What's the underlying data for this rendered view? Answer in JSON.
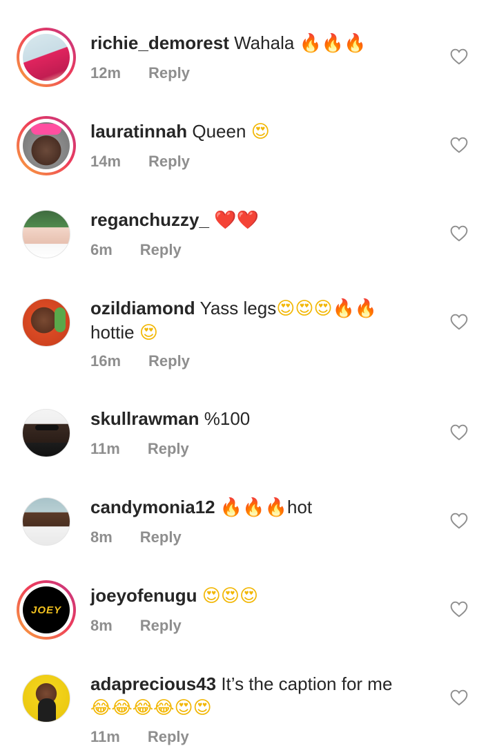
{
  "comments": [
    {
      "username": "richie_demorest",
      "text": "Wahala",
      "emoji": "🔥🔥🔥",
      "emoji2": "",
      "time": "12m",
      "reply": "Reply"
    },
    {
      "username": "lauratinnah",
      "text": "Queen",
      "emoji": "😍",
      "emoji2": "",
      "time": "14m",
      "reply": "Reply"
    },
    {
      "username": "reganchuzzy_",
      "text": "",
      "emoji": "❤️❤️",
      "emoji2": "",
      "time": "6m",
      "reply": "Reply"
    },
    {
      "username": "ozildiamond",
      "text": "Yass legs",
      "emoji": "😍😍😍🔥🔥",
      "line2": "hottie",
      "emoji2": "😍",
      "time": "16m",
      "reply": "Reply"
    },
    {
      "username": "skullrawman",
      "text": "%100",
      "emoji": "",
      "emoji2": "",
      "time": "11m",
      "reply": "Reply"
    },
    {
      "username": "candymonia12",
      "text": "hot",
      "emoji": "🔥🔥🔥",
      "emoji2": "",
      "time": "8m",
      "reply": "Reply"
    },
    {
      "username": "joeyofenugu",
      "text": "",
      "emoji": "😍😍😍",
      "emoji2": "",
      "time": "8m",
      "reply": "Reply",
      "avatar_text": "JOEY"
    },
    {
      "username": "adaprecious43",
      "text": "It’s the caption for me",
      "emoji": "",
      "line2": "",
      "emoji2": "😂😂😂😂😍😍",
      "time": "11m",
      "reply": "Reply"
    }
  ],
  "colors": {
    "username": "#262626",
    "meta": "#8e8e8e",
    "ring_start": "#f9a93c",
    "ring_end": "#c13584"
  },
  "icons": {
    "like": "heart-outline-icon"
  }
}
